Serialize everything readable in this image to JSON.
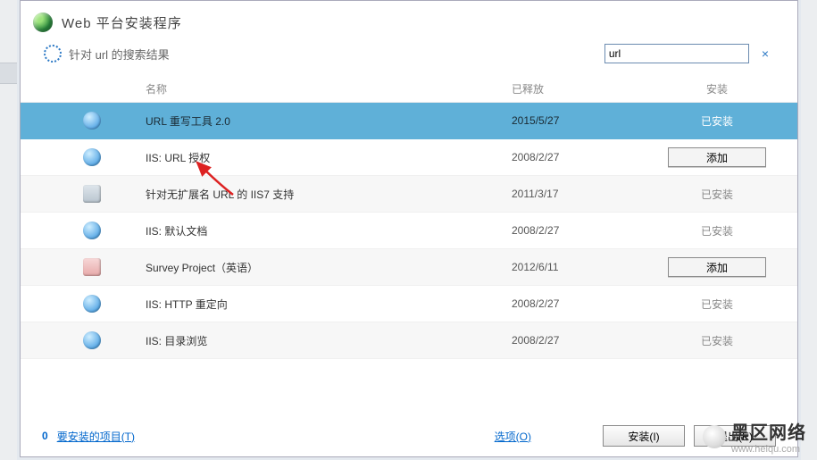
{
  "window": {
    "title": "Web 平台安装程序"
  },
  "search": {
    "label": "针对 url 的搜索结果",
    "value": "url",
    "clear_icon": "×"
  },
  "columns": {
    "name": "名称",
    "released": "已释放",
    "install": "安装"
  },
  "rows": [
    {
      "icon": "globe",
      "name": "URL 重写工具 2.0",
      "date": "2015/5/27",
      "state": "installed",
      "selected": true,
      "alt": false
    },
    {
      "icon": "globe",
      "name": "IIS: URL 授权",
      "date": "2008/2/27",
      "state": "add",
      "selected": false,
      "alt": false
    },
    {
      "icon": "box",
      "name": "针对无扩展名 URL 的 IIS7 支持",
      "date": "2011/3/17",
      "state": "installed",
      "selected": false,
      "alt": true
    },
    {
      "icon": "globe",
      "name": "IIS: 默认文档",
      "date": "2008/2/27",
      "state": "installed",
      "selected": false,
      "alt": false
    },
    {
      "icon": "red",
      "name": "Survey Project（英语）",
      "date": "2012/6/11",
      "state": "add",
      "selected": false,
      "alt": true
    },
    {
      "icon": "globe",
      "name": "IIS: HTTP 重定向",
      "date": "2008/2/27",
      "state": "installed",
      "selected": false,
      "alt": false
    },
    {
      "icon": "globe",
      "name": "IIS: 目录浏览",
      "date": "2008/2/27",
      "state": "installed",
      "selected": false,
      "alt": true
    }
  ],
  "labels": {
    "installed": "已安装",
    "add": "添加"
  },
  "footer": {
    "pending_count": "0",
    "pending_label": "要安装的项目(T)",
    "options": "选项(O)",
    "install_btn": "安装(I)",
    "exit_btn": "退出(E)"
  },
  "watermark": {
    "big": "黑区网络",
    "small": "www.heiqu.com"
  }
}
